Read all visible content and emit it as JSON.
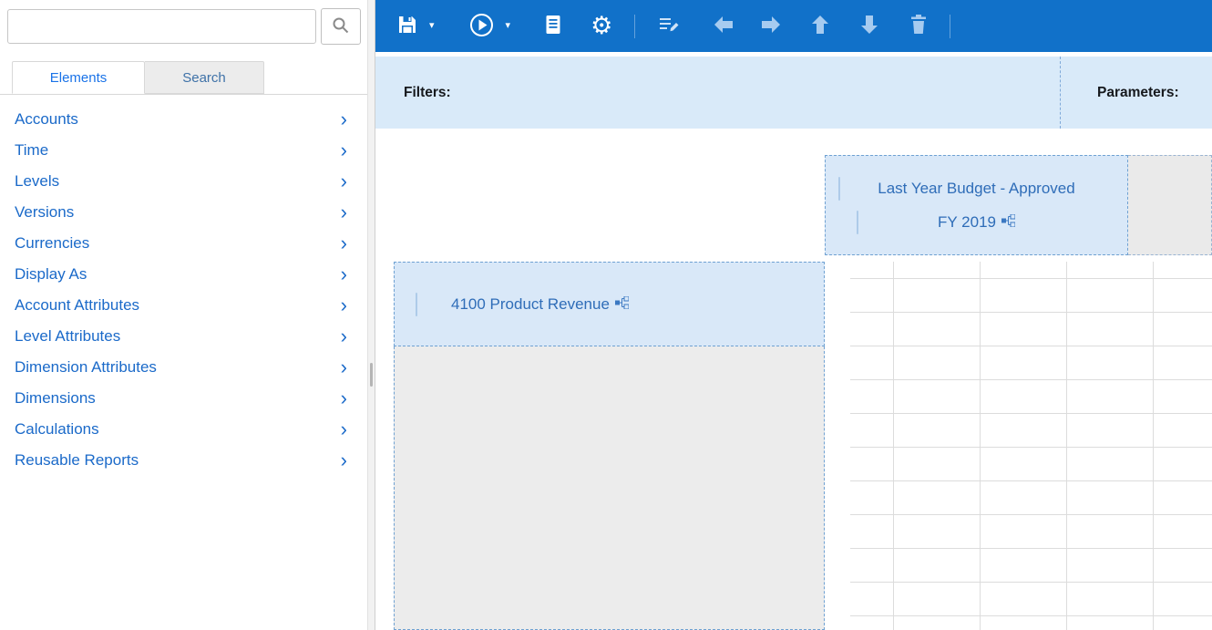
{
  "left_panel": {
    "search": {
      "value": ""
    },
    "tabs": {
      "elements": "Elements",
      "search": "Search"
    },
    "chevron": "›",
    "items": [
      "Accounts",
      "Time",
      "Levels",
      "Versions",
      "Currencies",
      "Display As",
      "Account Attributes",
      "Level Attributes",
      "Dimension Attributes",
      "Dimensions",
      "Calculations",
      "Reusable Reports"
    ]
  },
  "toolbar": {
    "buttons": [
      "save",
      "save-menu",
      "run",
      "run-menu",
      "report",
      "settings",
      "modify",
      "move-left",
      "move-right",
      "move-up",
      "move-down",
      "delete"
    ],
    "glyphs": {
      "caret": "▾",
      "gear": "⚙"
    }
  },
  "bar": {
    "filters_label": "Filters:",
    "parameters_label": "Parameters:"
  },
  "canvas": {
    "column_zone": {
      "version": "Last Year Budget - Approved",
      "time": "FY 2019"
    },
    "row_zone": {
      "account": "4100 Product Revenue"
    }
  },
  "colors": {
    "toolbar_blue": "#1171c9",
    "filters_bar_blue": "#d9eaf9",
    "dropzone_blue": "#d9e8f8",
    "link_blue": "#1b6ac9"
  }
}
